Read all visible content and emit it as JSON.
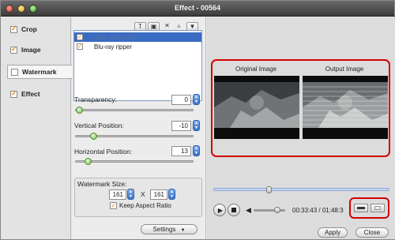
{
  "window": {
    "title": "Effect - 00564"
  },
  "sidebar": {
    "items": [
      {
        "label": "Crop",
        "checked": true
      },
      {
        "label": "Image",
        "checked": true
      },
      {
        "label": "Watermark",
        "checked": false,
        "active": true
      },
      {
        "label": "Effect",
        "checked": true
      }
    ]
  },
  "watermark": {
    "toolbar": [
      "text-icon",
      "image-icon",
      "delete-icon",
      "move-up-icon",
      "move-down-icon"
    ],
    "files": [
      {
        "name": "IMG_0003.JPG",
        "checked": true,
        "selected": true
      },
      {
        "name": "Blu-ray ripper",
        "checked": true,
        "selected": false
      }
    ],
    "transparency_label": "Transparency:",
    "transparency_value": "0",
    "vertical_label": "Vertical Position:",
    "vertical_value": "-10",
    "horizontal_label": "Horizontal Position:",
    "horizontal_value": "13",
    "size_label": "Watermark Size:",
    "width_value": "161",
    "x_label": "X",
    "height_value": "161",
    "keep_aspect_label": "Keep Aspect Ratio",
    "keep_aspect_checked": true,
    "settings_label": "Settings"
  },
  "preview": {
    "original_label": "Original Image",
    "output_label": "Output Image"
  },
  "player": {
    "time_current": "00:33:43",
    "time_separator": "/",
    "time_total": "01:48:3"
  },
  "footer": {
    "apply_label": "Apply",
    "close_label": "Close"
  },
  "colors": {
    "highlight_red": "#d40000",
    "selection_blue": "#3a6bc3",
    "checkbox_orange": "#d97a00"
  }
}
